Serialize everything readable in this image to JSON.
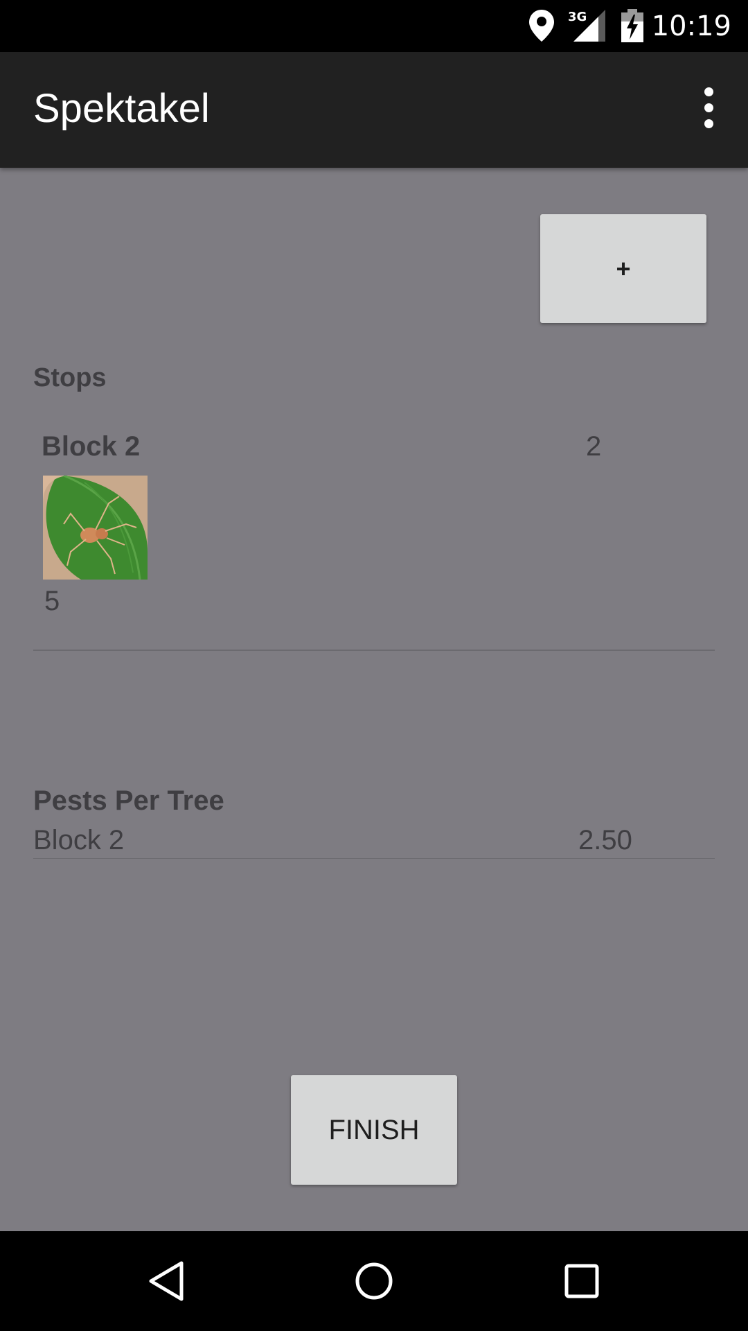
{
  "status_bar": {
    "time": "10:19",
    "network_label": "3G",
    "icons": [
      "location-icon",
      "signal-icon",
      "battery-charging-icon"
    ]
  },
  "toolbar": {
    "title": "Spektakel",
    "menu_icon": "overflow-menu-icon"
  },
  "main": {
    "add_button_label": "+",
    "stops": {
      "heading": "Stops",
      "items": [
        {
          "name": "Block 2",
          "count": "2",
          "image_icon": "pest-photo-spider",
          "pest_count": "5"
        }
      ]
    },
    "pests_per_tree": {
      "heading": "Pests Per Tree",
      "rows": [
        {
          "block": "Block 2",
          "value": "2.50"
        }
      ]
    },
    "finish_button_label": "FINISH"
  },
  "nav_bar": {
    "icons": [
      "back-icon",
      "home-icon",
      "recents-icon"
    ]
  },
  "colors": {
    "background": "#7e7c82",
    "toolbar": "#212121",
    "button": "#d6d7d7",
    "text": "#3f3e42"
  }
}
